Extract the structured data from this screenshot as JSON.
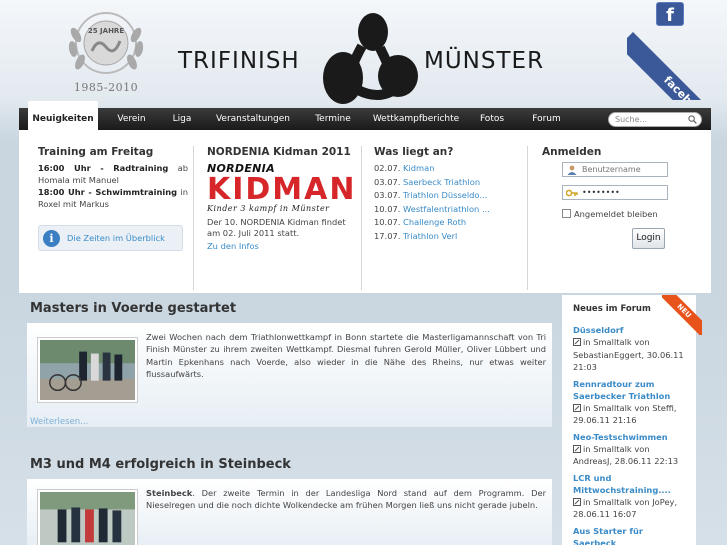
{
  "header": {
    "anniversary_label": "25 JAHRE",
    "anniversary_years": "1985-2010",
    "logo_left": "TRIFINISH",
    "logo_right": "MÜNSTER",
    "facebook_label": "facebook",
    "facebook_glyph": "f"
  },
  "nav": {
    "items": [
      {
        "label": "Neuigkeiten"
      },
      {
        "label": "Verein"
      },
      {
        "label": "Liga"
      },
      {
        "label": "Veranstaltungen"
      },
      {
        "label": "Termine"
      },
      {
        "label": "Wettkampfberichte"
      },
      {
        "label": "Fotos"
      },
      {
        "label": "Forum"
      }
    ],
    "search_placeholder": "Suche..."
  },
  "training": {
    "title": "Training am Freitag",
    "line1_time": "16:00 Uhr - Radtraining",
    "line1_rest": " ab Homala mit Manuel",
    "line2_time": "18:00 Uhr - Schwimmtraining",
    "line2_rest": " in Roxel mit Markus",
    "info_link": "Die Zeiten im Überblick"
  },
  "kidman": {
    "title": "NORDENIA Kidman 2011",
    "logo_top": "NORDENIA",
    "logo_big": "KIDMAN",
    "logo_sub": "Kinder 3 kampf in Münster",
    "text": "Der 10. NORDENIA Kidman findet am 02. Juli 2011 statt.",
    "link": "Zu den Infos"
  },
  "liegt_an": {
    "title": "Was liegt an?",
    "rows": [
      {
        "date": "02.07.",
        "label": "Kidman"
      },
      {
        "date": "03.07.",
        "label": "Saerbeck Triathlon"
      },
      {
        "date": "03.07.",
        "label": "Triathlon Düsseldo..."
      },
      {
        "date": "10.07.",
        "label": "Westfalentriathlon ..."
      },
      {
        "date": "10.07.",
        "label": "Challenge Roth"
      },
      {
        "date": "17.07.",
        "label": "Triathlon Verl"
      }
    ]
  },
  "login": {
    "title": "Anmelden",
    "username_placeholder": "Benutzername",
    "password_value": "••••••••",
    "remember_label": "Angemeldet bleiben",
    "button_label": "Login"
  },
  "articles": [
    {
      "title": "Masters in Voerde gestartet",
      "text": "Zwei Wochen nach dem Triathlonwettkampf in Bonn startete die Masterligamannschaft von Tri Finish Münster zu ihrem zweiten Wettkampf. Diesmal fuhren Gerold Müller, Oliver Lübbert und Martin Epkenhans nach Voerde, also wieder in die Nähe des Rheins, nur etwas weiter flussaufwärts.",
      "read_more": "Weiterlesen..."
    },
    {
      "title": "M3 und M4 erfolgreich in Steinbeck",
      "text_bold": "Steinbeck",
      "text": ". Der zweite Termin in der Landesliga Nord stand auf dem Programm. Der Nieselregen und die noch dichte Wolkendecke am frühen Morgen ließ uns nicht gerade jubeln."
    }
  ],
  "forum": {
    "title": "Neues im Forum",
    "ribbon": "NEU",
    "items": [
      {
        "title": "Düsseldorf",
        "meta": "in Smalltalk von SebastianEggert, 30.06.11 21:03"
      },
      {
        "title": "Rennradtour zum Saerbecker Triathlon",
        "meta": "in Smalltalk von Steffi, 29.06.11 21:16"
      },
      {
        "title": "Neo-Testschwimmen",
        "meta": "in Smalltalk von AndreasJ, 28.06.11 22:13"
      },
      {
        "title": "LCR und Mittwochstraining....",
        "meta": "in Smalltalk von JoPey, 28.06.11 16:07"
      },
      {
        "title": "Aus Starter für Saerbeck",
        "meta": ""
      }
    ]
  },
  "colors": {
    "link": "#3a8bc7",
    "nav_bg": "#1a1a1a",
    "kidman_red": "#d6262a",
    "facebook_blue": "#3b5998",
    "neu_orange": "#e8531c"
  }
}
